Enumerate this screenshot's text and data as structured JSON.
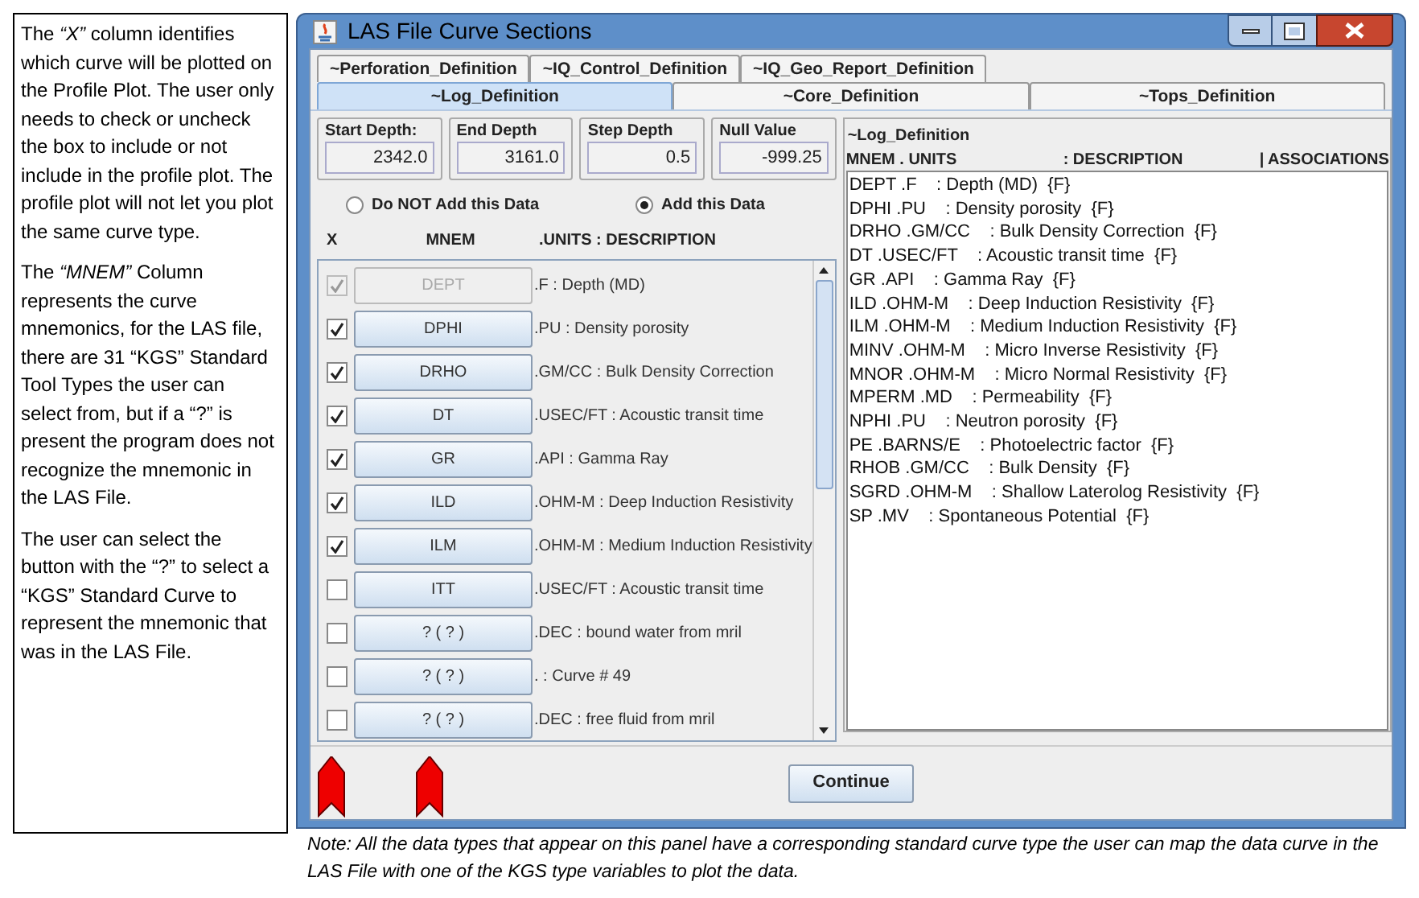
{
  "help_paragraphs": [
    "The *“X”* column identifies which curve will be plotted on the Profile Plot.  The user only needs to check or uncheck the box to include or not include  in the profile plot.  The profile plot will not let you plot the same curve type.",
    "The *“MNEM”* Column represents the curve mnemonics, for the LAS file, there are 31  “KGS” Standard Tool Types the user can select from, but if a “?” is present the program does not recognize the  mnemonic in the LAS File.",
    "The user can select the button with the “?” to select a “KGS” Standard Curve to represent the mnemonic that was in the LAS File."
  ],
  "window": {
    "title": "LAS File Curve Sections"
  },
  "tab_rows": [
    [
      {
        "label": "~Perforation_Definition",
        "selected": false
      },
      {
        "label": "~IQ_Control_Definition",
        "selected": false
      },
      {
        "label": "~IQ_Geo_Report_Definition",
        "selected": false
      }
    ],
    [
      {
        "label": "~Log_Definition",
        "selected": true
      },
      {
        "label": "~Core_Definition",
        "selected": false
      },
      {
        "label": "~Tops_Definition",
        "selected": false
      }
    ]
  ],
  "fields": [
    {
      "label": "Start Depth:",
      "value": "2342.0"
    },
    {
      "label": "End Depth",
      "value": "3161.0"
    },
    {
      "label": "Step Depth",
      "value": "0.5"
    },
    {
      "label": "Null Value",
      "value": "-999.25"
    }
  ],
  "radios": [
    {
      "label": "Do NOT Add this Data",
      "selected": false
    },
    {
      "label": "Add this Data",
      "selected": true
    }
  ],
  "columns": [
    "X",
    "MNEM",
    ".UNITS  : DESCRIPTION"
  ],
  "curves": [
    {
      "checked": true,
      "disabled": true,
      "mnem": "DEPT",
      "description": ".F : Depth (MD)"
    },
    {
      "checked": true,
      "disabled": false,
      "mnem": "DPHI",
      "description": ".PU : Density porosity"
    },
    {
      "checked": true,
      "disabled": false,
      "mnem": "DRHO",
      "description": ".GM/CC : Bulk Density Correction"
    },
    {
      "checked": true,
      "disabled": false,
      "mnem": "DT",
      "description": ".USEC/FT : Acoustic transit time"
    },
    {
      "checked": true,
      "disabled": false,
      "mnem": "GR",
      "description": ".API : Gamma Ray"
    },
    {
      "checked": true,
      "disabled": false,
      "mnem": "ILD",
      "description": ".OHM-M : Deep Induction Resistivity"
    },
    {
      "checked": true,
      "disabled": false,
      "mnem": "ILM",
      "description": ".OHM-M : Medium Induction Resistivity"
    },
    {
      "checked": false,
      "disabled": false,
      "mnem": "ITT",
      "description": ".USEC/FT : Acoustic transit time"
    },
    {
      "checked": false,
      "disabled": false,
      "mnem": "? ( ? )",
      "description": ".DEC : bound water from mril"
    },
    {
      "checked": false,
      "disabled": false,
      "mnem": "? ( ? )",
      "description": ". : Curve #  49"
    },
    {
      "checked": false,
      "disabled": false,
      "mnem": "? ( ? )",
      "description": ".DEC : free fluid from mril"
    }
  ],
  "log_panel": {
    "title": "~Log_Definition",
    "header": [
      "MNEM . UNITS",
      ": DESCRIPTION",
      "| ASSOCIATIONS"
    ],
    "lines": [
      "DEPT .F    : Depth (MD)  {F}",
      "DPHI .PU    : Density porosity  {F}",
      "DRHO .GM/CC    : Bulk Density Correction  {F}",
      "DT .USEC/FT    : Acoustic transit time  {F}",
      "GR .API    : Gamma Ray  {F}",
      "ILD .OHM-M    : Deep Induction Resistivity  {F}",
      "ILM .OHM-M    : Medium Induction Resistivity  {F}",
      "MINV .OHM-M    : Micro Inverse Resistivity  {F}",
      "MNOR .OHM-M    : Micro Normal Resistivity  {F}",
      "MPERM .MD    : Permeability  {F}",
      "NPHI .PU    : Neutron porosity  {F}",
      "PE .BARNS/E    : Photoelectric factor  {F}",
      "RHOB .GM/CC    : Bulk Density  {F}",
      "SGRD .OHM-M    : Shallow Laterolog Resistivity  {F}",
      "SP .MV    : Spontaneous Potential  {F}"
    ]
  },
  "buttons": [
    "Continue"
  ],
  "note": "*Note:  All the data types that appear on this panel have a corresponding standard curve type the user can map the data curve in the LAS File with one of the KGS type variables to plot the data.*"
}
